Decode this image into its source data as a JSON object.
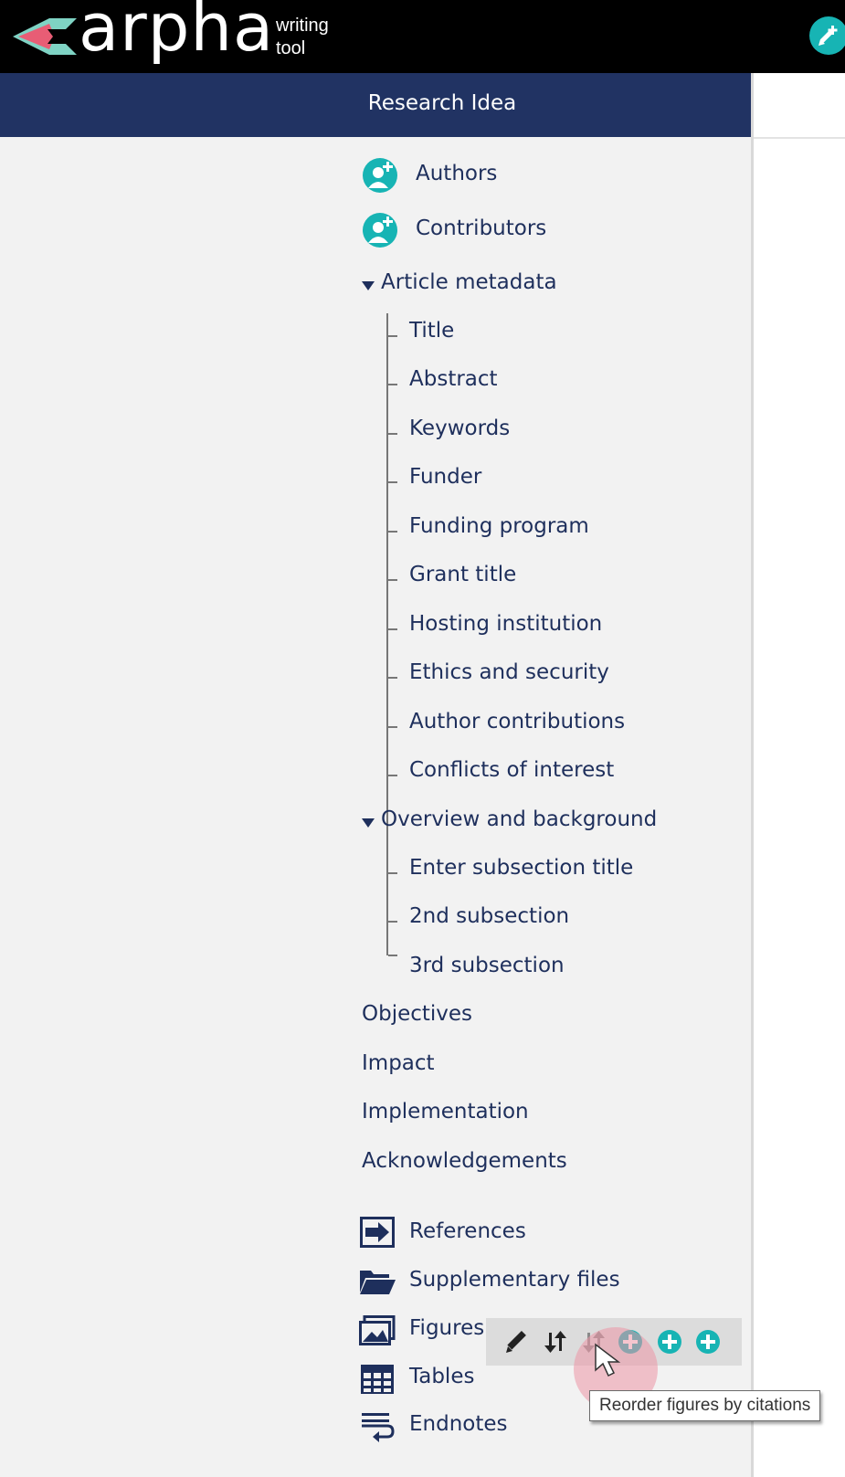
{
  "app": {
    "logo_text": "arpha",
    "logo_sub_line1": "writing",
    "logo_sub_line2": "tool",
    "document_title": "Research Idea",
    "accent_color": "#17b4b4",
    "header_color": "#213363"
  },
  "people": [
    {
      "label": "Authors",
      "icon": "add-person-icon"
    },
    {
      "label": "Contributors",
      "icon": "add-person-icon"
    }
  ],
  "article_metadata": {
    "label": "Article metadata",
    "expanded": true,
    "items": [
      "Title",
      "Abstract",
      "Keywords",
      "Funder",
      "Funding program",
      "Grant title",
      "Hosting institution",
      "Ethics and security",
      "Author contributions",
      "Conflicts of interest"
    ]
  },
  "overview": {
    "label": "Overview and background",
    "expanded": true,
    "items": [
      "Enter subsection title",
      "2nd subsection",
      "3rd subsection"
    ]
  },
  "sections": [
    "Objectives",
    "Impact",
    "Implementation",
    "Acknowledgements"
  ],
  "extras": [
    {
      "label": "References",
      "icon": "references-icon"
    },
    {
      "label": "Supplementary files",
      "icon": "folder-icon"
    },
    {
      "label": "Figures",
      "icon": "image-icon"
    },
    {
      "label": "Tables",
      "icon": "table-icon"
    },
    {
      "label": "Endnotes",
      "icon": "endnote-icon"
    }
  ],
  "figures_toolbar": {
    "buttons": [
      "edit-icon",
      "reorder-icon",
      "reorder-by-citations-icon",
      "add-icon",
      "add-icon",
      "add-icon"
    ]
  },
  "tooltip": "Reorder figures by citations"
}
